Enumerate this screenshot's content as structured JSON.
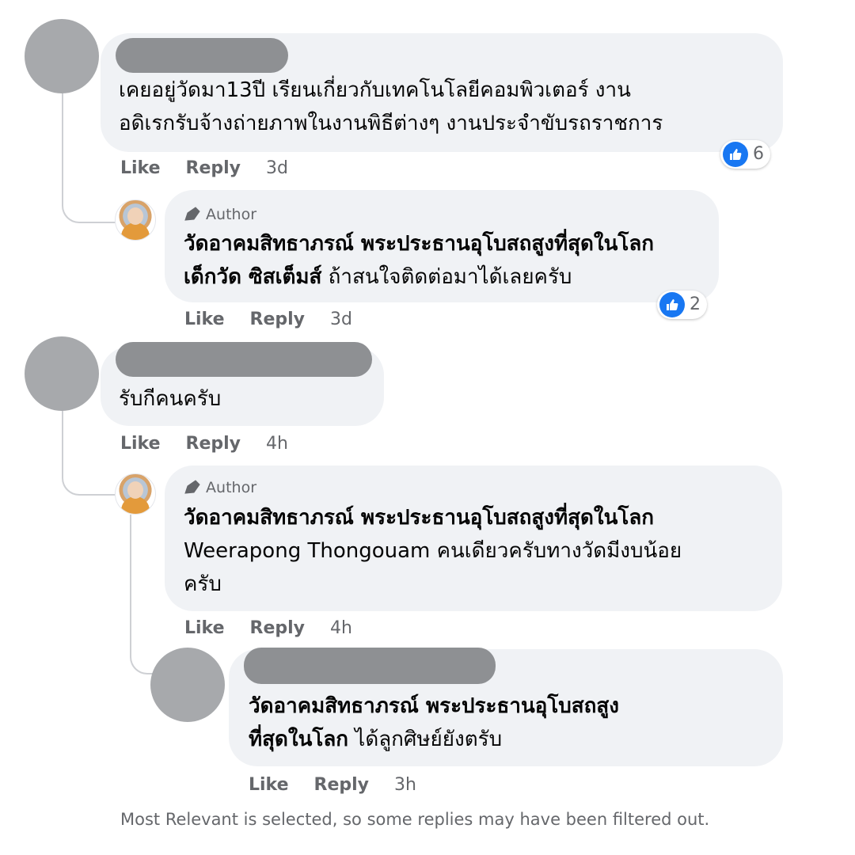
{
  "comments": [
    {
      "text_lines": [
        "เคยอยู่วัดมา13ปี เรียนเกี่ยวกับเทคโนโลยีคอมพิวเตอร์ งาน",
        "อดิเรกรับจ้างถ่ายภาพในงานพิธีต่างๆ งานประจำขับรถราชการ"
      ],
      "reactions": "6",
      "actions": {
        "like": "Like",
        "reply": "Reply",
        "time": "3d"
      }
    },
    {
      "author_badge": "Author",
      "name": "วัดอาคมสิทธาภรณ์ พระประธานอุโบสถสูงที่สุดในโลก",
      "mention": "เด็กวัด ซิสเต็มส์",
      "text": " ถ้าสนใจติดต่อมาได้เลยครับ",
      "reactions": "2",
      "actions": {
        "like": "Like",
        "reply": "Reply",
        "time": "3d"
      }
    },
    {
      "text_lines": [
        "รับกีคนครับ"
      ],
      "actions": {
        "like": "Like",
        "reply": "Reply",
        "time": "4h"
      }
    },
    {
      "author_badge": "Author",
      "name": "วัดอาคมสิทธาภรณ์ พระประธานอุโบสถสูงที่สุดในโลก",
      "text_lines": [
        "Weerapong Thongouam คนเดียวครับทางวัดมีงบน้อย",
        "ครับ"
      ],
      "actions": {
        "like": "Like",
        "reply": "Reply",
        "time": "4h"
      }
    },
    {
      "mention_lines": [
        "วัดอาคมสิทธาภรณ์ พระประธานอุโบสถสูง",
        "ที่สุดในโลก"
      ],
      "text": " ได้ลูกศิษย์ยังตรับ",
      "actions": {
        "like": "Like",
        "reply": "Reply",
        "time": "3h"
      }
    }
  ],
  "footer_note": "Most Relevant is selected, so some replies may have been filtered out.",
  "colors": {
    "bubble": "#f0f2f5",
    "meta_text": "#65676b",
    "like_blue": "#1877f2",
    "redaction": "#8e9093"
  }
}
